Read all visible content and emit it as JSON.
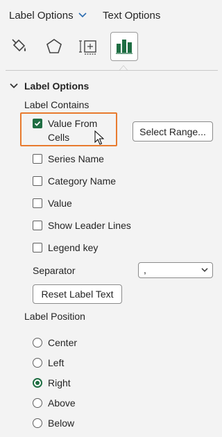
{
  "tabs": {
    "label_options": "Label Options",
    "text_options": "Text Options"
  },
  "icons": [
    "fill-line-icon",
    "effects-icon",
    "size-properties-icon",
    "label-options-chart-icon"
  ],
  "section": {
    "title": "Label Options"
  },
  "label_contains": {
    "heading": "Label Contains",
    "value_from_cells": {
      "label": "Value From Cells",
      "checked": true
    },
    "select_range_button": "Select Range...",
    "items": [
      {
        "label": "Series Name",
        "checked": false
      },
      {
        "label": "Category Name",
        "checked": false
      },
      {
        "label": "Value",
        "checked": false
      },
      {
        "label": "Show Leader Lines",
        "checked": false
      },
      {
        "label": "Legend key",
        "checked": false
      }
    ],
    "separator": {
      "label": "Separator",
      "value": ","
    },
    "reset_button": "Reset Label Text"
  },
  "label_position": {
    "heading": "Label Position",
    "options": [
      {
        "label": "Center",
        "selected": false
      },
      {
        "label": "Left",
        "selected": false
      },
      {
        "label": "Right",
        "selected": true
      },
      {
        "label": "Above",
        "selected": false
      },
      {
        "label": "Below",
        "selected": false
      }
    ]
  },
  "colors": {
    "accent": "#1f6e43",
    "highlight": "#e87a2e"
  }
}
